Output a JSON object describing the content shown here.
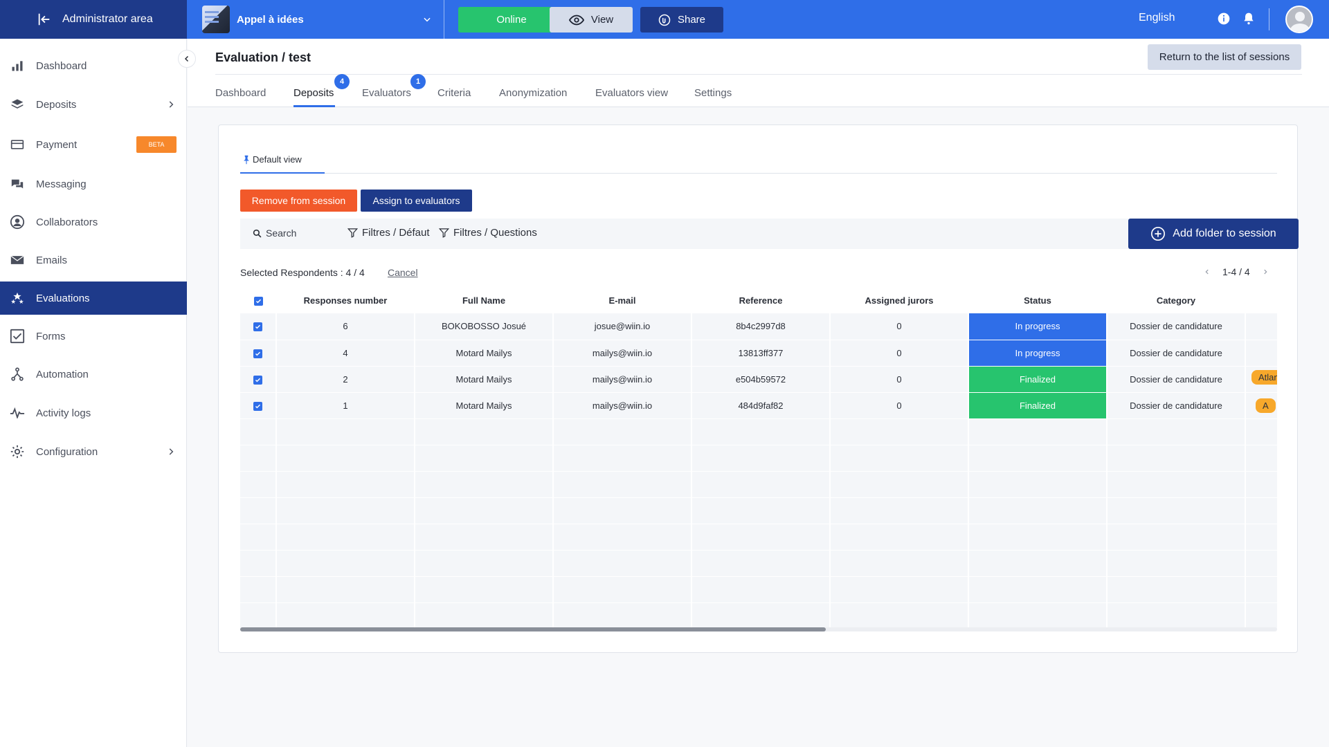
{
  "topbar": {
    "admin_label": "Administrator area",
    "project_name": "Appel à idées",
    "online_label": "Online",
    "view_label": "View",
    "share_label": "Share",
    "language": "English"
  },
  "sidebar": {
    "items": [
      {
        "label": "Dashboard",
        "icon": "bar-chart-icon"
      },
      {
        "label": "Deposits",
        "icon": "layers-icon"
      },
      {
        "label": "Payment",
        "icon": "credit-card-icon",
        "badge": "BETA"
      },
      {
        "label": "Messaging",
        "icon": "chat-icon"
      },
      {
        "label": "Collaborators",
        "icon": "user-circle-icon"
      },
      {
        "label": "Emails",
        "icon": "envelope-icon"
      },
      {
        "label": "Evaluations",
        "icon": "stars-icon"
      },
      {
        "label": "Forms",
        "icon": "checkbox-icon"
      },
      {
        "label": "Automation",
        "icon": "automation-icon"
      },
      {
        "label": "Activity logs",
        "icon": "pulse-icon"
      },
      {
        "label": "Configuration",
        "icon": "gear-icon"
      }
    ]
  },
  "header": {
    "title": "Evaluation / test",
    "return_label": "Return to the list of sessions",
    "tabs": [
      {
        "label": "Dashboard"
      },
      {
        "label": "Deposits",
        "badge": "4"
      },
      {
        "label": "Evaluators",
        "badge": "1"
      },
      {
        "label": "Criteria"
      },
      {
        "label": "Anonymization"
      },
      {
        "label": "Evaluators view"
      },
      {
        "label": "Settings"
      }
    ]
  },
  "main": {
    "view_tab": "Default view",
    "remove_label": "Remove from session",
    "assign_label": "Assign to evaluators",
    "search_label": "Search",
    "filter_default": "Filtres / Défaut",
    "filter_questions": "Filtres / Questions",
    "add_folder_label": "Add folder to session",
    "selected_text": "Selected Respondents : 4 / 4",
    "cancel_label": "Cancel",
    "pager_label": "1-4 / 4"
  },
  "table": {
    "columns": [
      "Responses number",
      "Full Name",
      "E-mail",
      "Reference",
      "Assigned jurors",
      "Status",
      "Category"
    ],
    "rows": [
      {
        "number": "6",
        "name": "BOKOBOSSO Josué",
        "email": "josue@wiin.io",
        "reference": "8b4c2997d8",
        "jurors": "0",
        "status": "In progress",
        "category": "Dossier de candidature",
        "tag": ""
      },
      {
        "number": "4",
        "name": "Motard Mailys",
        "email": "mailys@wiin.io",
        "reference": "13813ff377",
        "jurors": "0",
        "status": "In progress",
        "category": "Dossier de candidature",
        "tag": ""
      },
      {
        "number": "2",
        "name": "Motard Mailys",
        "email": "mailys@wiin.io",
        "reference": "e504b59572",
        "jurors": "0",
        "status": "Finalized",
        "category": "Dossier de candidature",
        "tag": "Atlan"
      },
      {
        "number": "1",
        "name": "Motard Mailys",
        "email": "mailys@wiin.io",
        "reference": "484d9faf82",
        "jurors": "0",
        "status": "Finalized",
        "category": "Dossier de candidature",
        "tag": "A"
      }
    ]
  },
  "colors": {
    "primary": "#2f6ee8",
    "navy": "#1e3a8a",
    "green": "#27c46e",
    "orange": "#f2592a",
    "beta": "#f7882b"
  }
}
